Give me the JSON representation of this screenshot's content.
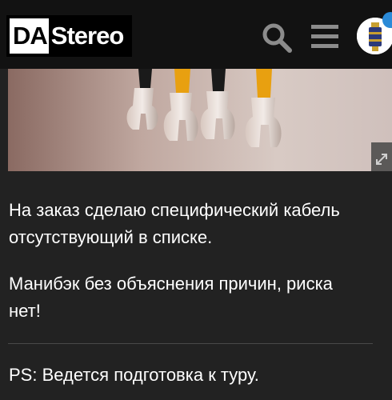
{
  "header": {
    "logo_da": "DA",
    "logo_stereo": "Stereo",
    "search_icon": "search-icon",
    "menu_icon": "hamburger-menu-icon",
    "avatar_icon": "user-avatar",
    "accent_color": "#2a8ad8"
  },
  "hero": {
    "image": "photo of spade connector terminals",
    "expand_icon": "expand-icon"
  },
  "post": {
    "para1_line1": "На заказ сделаю специфический кабель",
    "para1_line2": "отсутствующий в списке.",
    "para2_line1": "Манибэк без объяснения причин, риска",
    "para2_line2": "нет!",
    "ps": "PS: Ведется подготовка к туру."
  }
}
